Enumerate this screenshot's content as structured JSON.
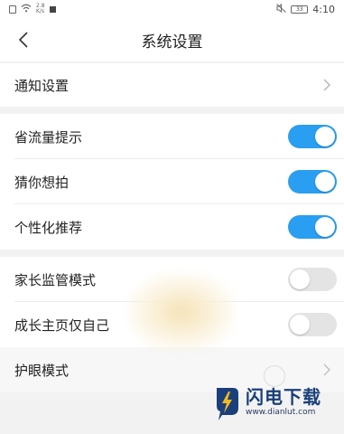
{
  "status_bar": {
    "speed_value": "2.8",
    "speed_unit": "K/s",
    "battery": "33",
    "time": "4:10"
  },
  "header": {
    "title": "系统设置"
  },
  "rows": [
    {
      "label": "通知设置",
      "control": "chevron"
    },
    {
      "label": "省流量提示",
      "control": "toggle",
      "value": true
    },
    {
      "label": "猜你想拍",
      "control": "toggle",
      "value": true
    },
    {
      "label": "个性化推荐",
      "control": "toggle",
      "value": true
    },
    {
      "label": "家长监管模式",
      "control": "toggle",
      "value": false
    },
    {
      "label": "成长主页仅自己",
      "control": "toggle",
      "value": false
    },
    {
      "label": "护眼模式",
      "control": "chevron"
    }
  ],
  "colors": {
    "toggle_on": "#2a9ef0",
    "toggle_off": "#e4e4e4"
  },
  "watermark": {
    "name": "闪电下载",
    "url": "www.dianlut.com"
  }
}
